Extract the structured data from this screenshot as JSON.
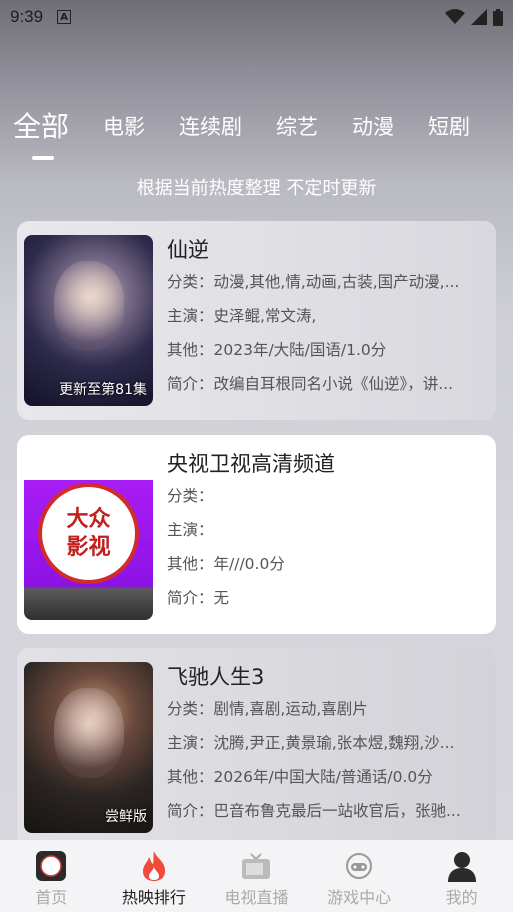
{
  "status": {
    "time": "9:39",
    "notif": "A"
  },
  "tabs": [
    {
      "label": "全部",
      "active": true
    },
    {
      "label": "电影",
      "active": false
    },
    {
      "label": "连续剧",
      "active": false
    },
    {
      "label": "综艺",
      "active": false
    },
    {
      "label": "动漫",
      "active": false
    },
    {
      "label": "短剧",
      "active": false
    }
  ],
  "subtitle": "根据当前热度整理 不定时更新",
  "items": [
    {
      "title": "仙逆",
      "category": "分类：动漫,其他,情,动画,古装,国产动漫,...",
      "cast": "主演：史泽鲲,常文涛,",
      "other": "其他：2023年/大陆/国语/1.0分",
      "intro": "简介：改编自耳根同名小说《仙逆》，讲...",
      "tag": "更新至第81集"
    },
    {
      "title": "央视卫视高清频道",
      "category": "分类：",
      "cast": "主演：",
      "other": "其他：年///0.0分",
      "intro": "简介：无",
      "tag": "",
      "logo_line1": "大众",
      "logo_line2": "影视"
    },
    {
      "title": "飞驰人生3",
      "category": "分类：剧情,喜剧,运动,喜剧片",
      "cast": "主演：沈腾,尹正,黄景瑜,张本煜,魏翔,沙...",
      "other": "其他：2026年/中国大陆/普通话/0.0分",
      "intro": "简介：巴音布鲁克最后一站收官后，张驰...",
      "tag": "尝鲜版"
    }
  ],
  "nav": [
    {
      "label": "首页",
      "icon": "app-logo-icon",
      "active": false
    },
    {
      "label": "热映排行",
      "icon": "fire-icon",
      "active": true
    },
    {
      "label": "电视直播",
      "icon": "tv-icon",
      "active": false
    },
    {
      "label": "游戏中心",
      "icon": "gamepad-icon",
      "active": false
    },
    {
      "label": "我的",
      "icon": "user-icon",
      "active": false
    }
  ],
  "colors": {
    "accent": "#f04a3a",
    "active_text": "#222222",
    "inactive_text": "#aaaaaa"
  }
}
